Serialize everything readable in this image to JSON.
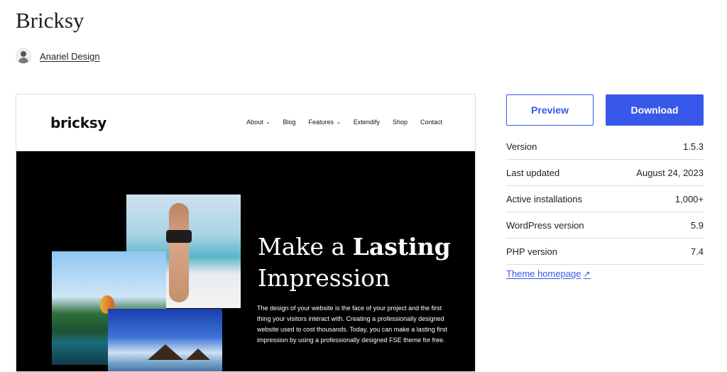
{
  "theme": {
    "name": "Bricksy"
  },
  "author": {
    "name": "Anariel Design"
  },
  "preview": {
    "logo": "bricksy",
    "nav": [
      {
        "label": "About",
        "has_dropdown": true
      },
      {
        "label": "Blog",
        "has_dropdown": false
      },
      {
        "label": "Features",
        "has_dropdown": true
      },
      {
        "label": "Extendify",
        "has_dropdown": false
      },
      {
        "label": "Shop",
        "has_dropdown": false
      },
      {
        "label": "Contact",
        "has_dropdown": false
      }
    ],
    "hero": {
      "title_part1": "Make a ",
      "title_bold": "Lasting",
      "title_part2": "Impression",
      "text": "The design of your website is the face of your project and the first thing your visitors interact with. Creating a professionally designed website used to cost thousands. Today, you can make a lasting first impression by using a professionally designed FSE theme for free."
    }
  },
  "actions": {
    "preview_label": "Preview",
    "download_label": "Download"
  },
  "meta": [
    {
      "label": "Version",
      "value": "1.5.3"
    },
    {
      "label": "Last updated",
      "value": "August 24, 2023"
    },
    {
      "label": "Active installations",
      "value": "1,000+"
    },
    {
      "label": "WordPress version",
      "value": "5.9"
    },
    {
      "label": "PHP version",
      "value": "7.4"
    }
  ],
  "links": {
    "homepage_label": "Theme homepage"
  },
  "colors": {
    "accent": "#3858e9",
    "text": "#1e1e1e",
    "border": "#dcdcde"
  }
}
